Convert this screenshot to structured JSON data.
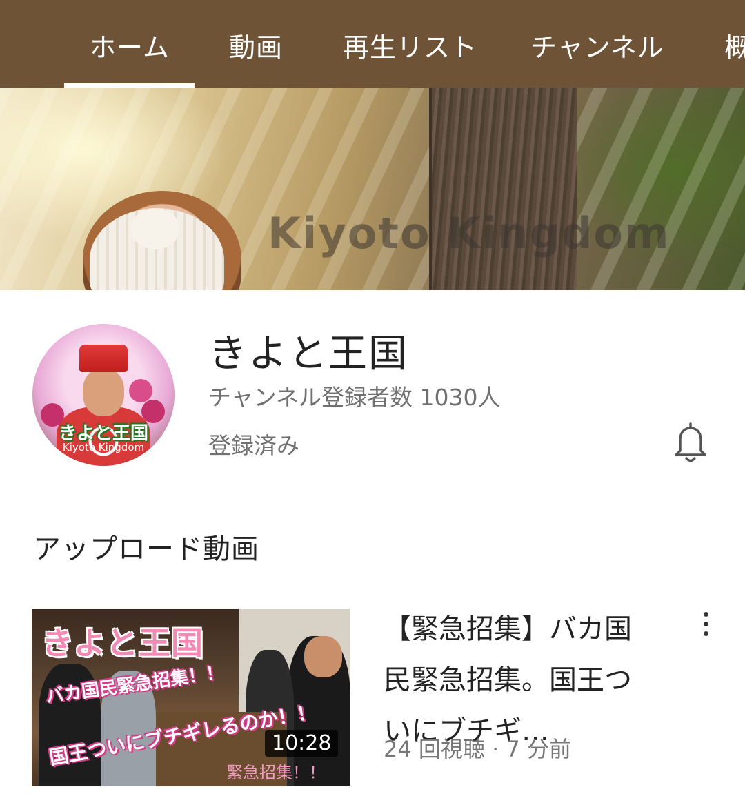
{
  "tabs": [
    {
      "label": "ホーム",
      "active": true
    },
    {
      "label": "動画",
      "active": false
    },
    {
      "label": "再生リスト",
      "active": false
    },
    {
      "label": "チャンネル",
      "active": false
    },
    {
      "label": "概",
      "active": false
    }
  ],
  "banner": {
    "text": "Kiyoto  Kingdom"
  },
  "channel": {
    "name": "きよと王国",
    "subscribers": "チャンネル登録者数 1030人",
    "status": "登録済み",
    "avatar_title": "きよと王国",
    "avatar_subtitle": "Kiyoto Kingdom"
  },
  "uploads": {
    "section_title": "アップロード動画",
    "videos": [
      {
        "title": "【緊急招集】バカ国民緊急招集。国王ついにブチギ…",
        "meta": "24 回視聴 · 7 分前",
        "duration": "10:28",
        "thumb_title": "きよと王国",
        "thumb_line1": "バカ国民緊急招集！！",
        "thumb_line2": "国王ついにブチギレるのか！！",
        "thumb_line3": "緊急招集！！"
      }
    ]
  },
  "colors": {
    "tabbar_bg": "#6e5337",
    "tab_text": "#ffffff"
  },
  "icons": {
    "bell": "bell-icon",
    "more": "more-vert-icon"
  }
}
